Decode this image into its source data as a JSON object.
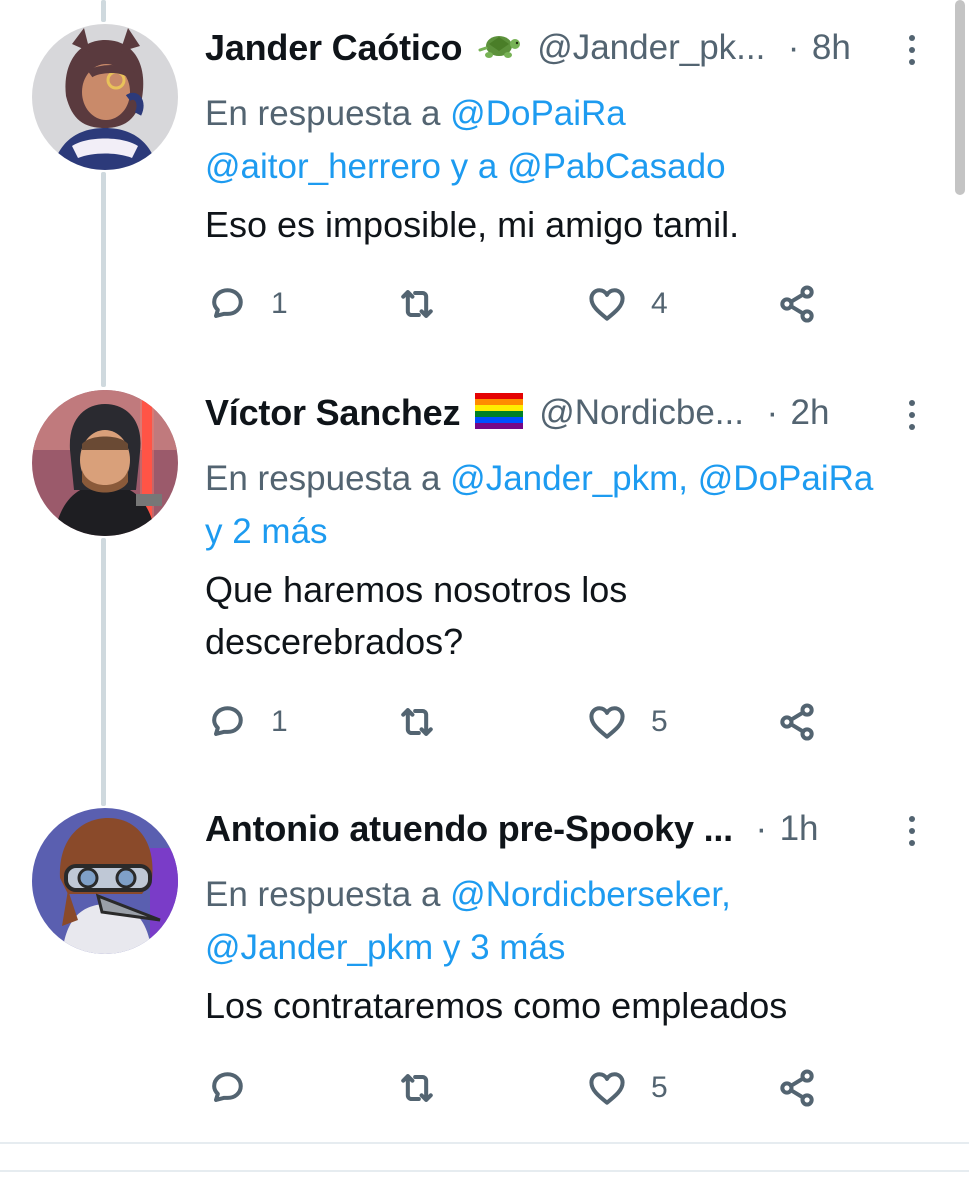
{
  "tweets": [
    {
      "name": "Jander Caótico",
      "badge": "turtle-emoji",
      "handle": "@Jander_pk...",
      "dot": "·",
      "time": "8h",
      "reply_prefix": "En respuesta a",
      "reply_1": "@DoPaiRa",
      "reply_2": "@aitor_herrero",
      "reply_join": "y a",
      "reply_3": "@PabCasado",
      "text": "Eso es imposible, mi amigo tamil.",
      "replies": "1",
      "retweets": "",
      "likes": "4"
    },
    {
      "name": "Víctor Sanchez",
      "badge": "rainbow-flag-emoji",
      "handle": "@Nordicbe...",
      "dot": "·",
      "time": "2h",
      "reply_prefix": "En respuesta a",
      "reply_1": "@Jander_pkm,",
      "reply_2": "@DoPaiRa",
      "reply_3": "y 2 más",
      "text_line1": "Que haremos nosotros los",
      "text_line2": "descerebrados?",
      "replies": "1",
      "retweets": "",
      "likes": "5"
    },
    {
      "name": "Antonio atuendo pre-Spooky ...",
      "badge": "",
      "handle": "",
      "dot": "·",
      "time": "1h",
      "reply_prefix": "En respuesta a",
      "reply_1": "@Nordicberseker,",
      "reply_2": "@Jander_pkm",
      "reply_3": "y 3 más",
      "text": "Los contrataremos como empleados",
      "replies": "",
      "retweets": "",
      "likes": "5"
    }
  ],
  "icons": {
    "reply": "reply-icon",
    "retweet": "retweet-icon",
    "like": "heart-icon",
    "share": "share-icon",
    "more": "more-icon"
  },
  "colors": {
    "link": "#1d9bf0",
    "secondary_text": "#536471",
    "primary_text": "#0f1419",
    "thread_line": "#cfd9de"
  }
}
